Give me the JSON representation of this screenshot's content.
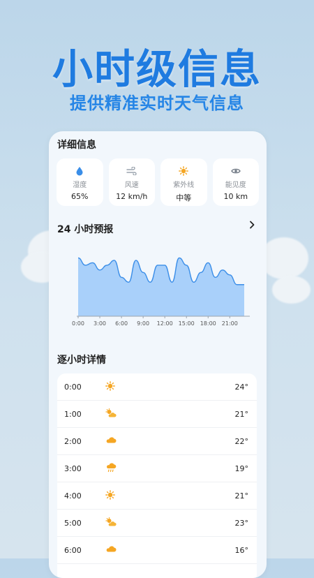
{
  "headline": "小时级信息",
  "subheadline": "提供精准实时天气信息",
  "details": {
    "title": "详细信息",
    "tiles": [
      {
        "icon": "humidity-drop-icon",
        "label": "湿度",
        "value": "65%"
      },
      {
        "icon": "wind-icon",
        "label": "风速",
        "value": "12 km/h"
      },
      {
        "icon": "sun-uv-icon",
        "label": "紫外线",
        "value": "中等"
      },
      {
        "icon": "eye-visibility-icon",
        "label": "能见度",
        "value": "10 km"
      }
    ]
  },
  "forecast": {
    "title": "24 小时预报",
    "more_icon": "chevron-right-icon"
  },
  "chart_data": {
    "type": "area",
    "x": [
      0,
      1,
      2,
      3,
      4,
      5,
      6,
      7,
      8,
      9,
      10,
      11,
      12,
      13,
      14,
      15,
      16,
      17,
      18,
      19,
      20,
      21,
      22,
      23
    ],
    "values": [
      24,
      21,
      22,
      19,
      21,
      23,
      16,
      14,
      23,
      18,
      14,
      21,
      21,
      14,
      24,
      21,
      14,
      18,
      22,
      16,
      19,
      17,
      13,
      13
    ],
    "tick_labels": [
      "0:00",
      "3:00",
      "6:00",
      "9:00",
      "12:00",
      "15:00",
      "18:00",
      "21:00"
    ],
    "tick_hours": [
      0,
      3,
      6,
      9,
      12,
      15,
      18,
      21
    ],
    "ylim": [
      0,
      27
    ],
    "colors": {
      "fill": "#a9d0fa",
      "line": "#3b8ee8"
    }
  },
  "hourly": {
    "title": "逐小时详情",
    "rows": [
      {
        "time": "0:00",
        "icon": "sun-icon",
        "temp": "24°"
      },
      {
        "time": "1:00",
        "icon": "partly-cloudy-icon",
        "temp": "21°"
      },
      {
        "time": "2:00",
        "icon": "cloud-icon",
        "temp": "22°"
      },
      {
        "time": "3:00",
        "icon": "rain-icon",
        "temp": "19°"
      },
      {
        "time": "4:00",
        "icon": "sun-icon",
        "temp": "21°"
      },
      {
        "time": "5:00",
        "icon": "partly-cloudy-icon",
        "temp": "23°"
      },
      {
        "time": "6:00",
        "icon": "cloud-icon",
        "temp": "16°"
      }
    ]
  }
}
